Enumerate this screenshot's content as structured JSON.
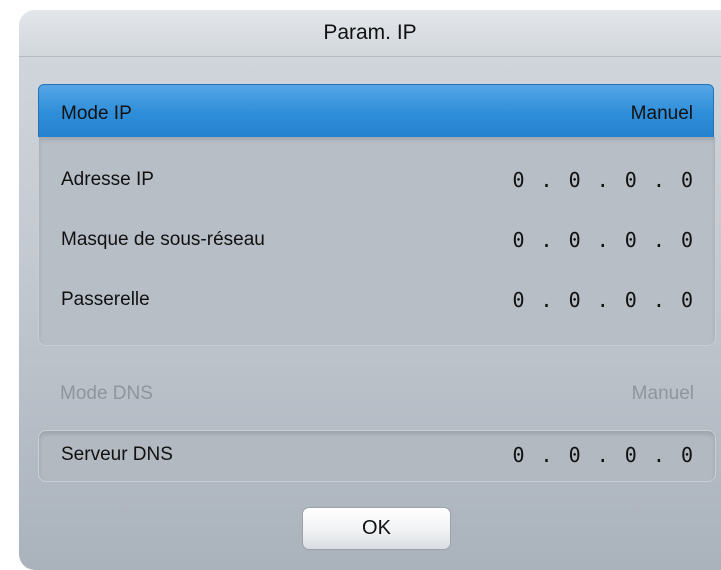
{
  "dialog": {
    "title": "Param. IP"
  },
  "ip_mode": {
    "label": "Mode IP",
    "value": "Manuel"
  },
  "ip_fields": [
    {
      "label": "Adresse IP",
      "value": "0.0.0.0"
    },
    {
      "label": "Masque de sous-réseau",
      "value": "0.0.0.0"
    },
    {
      "label": "Passerelle",
      "value": "0.0.0.0"
    }
  ],
  "dns_mode": {
    "label": "Mode DNS",
    "value": "Manuel"
  },
  "dns_server": {
    "label": "Serveur DNS",
    "value": "0.0.0.0"
  },
  "buttons": {
    "ok_label": "OK"
  },
  "colors": {
    "highlight": "#2f8ed9",
    "disabled_text": "#8e959d"
  }
}
